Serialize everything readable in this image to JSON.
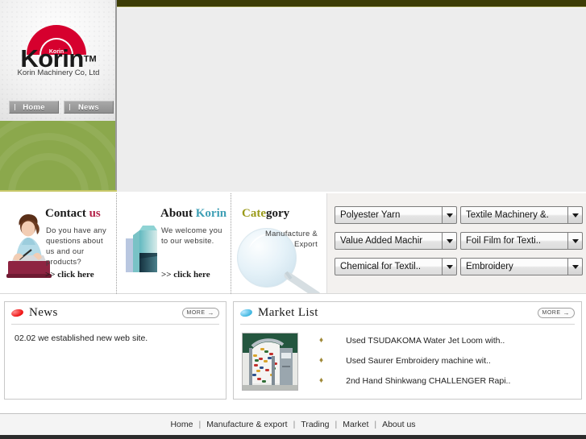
{
  "brand": {
    "name": "Korin",
    "tm": "TM",
    "company": "Korin Machinery Co, Ltd",
    "logo_icon": "concentric-arcs-logo",
    "logo_color": "#d6002e"
  },
  "nav_buttons": [
    {
      "label": "Home",
      "name": "nav-home"
    },
    {
      "label": "News",
      "name": "nav-news"
    }
  ],
  "promos": [
    {
      "title_main": "Contact",
      "title_accent": "us",
      "accent_class": "accent-red",
      "body": "Do you have any questions about us and our products?",
      "cta": ">> click here",
      "icon": "woman-at-desk-illustration"
    },
    {
      "title_main": "About",
      "title_accent": "Korin",
      "accent_class": "accent-teal",
      "body": "We welcome you to our website.",
      "cta": ">> click here",
      "icon": "office-building-illustration"
    },
    {
      "title_main": "Cate",
      "title_accent": "gory",
      "accent_class": "accent-gold",
      "body": "Manufacture & Export",
      "cta": "",
      "icon": "magnifying-glass-illustration"
    }
  ],
  "dropdowns": [
    {
      "value": "Polyester Yarn",
      "name": "dropdown-polyester-yarn"
    },
    {
      "value": "Textile Machinery &.",
      "name": "dropdown-textile-machinery"
    },
    {
      "value": "Value Added Machir",
      "name": "dropdown-value-added-machinery"
    },
    {
      "value": "Foil Film for Texti..",
      "name": "dropdown-foil-film"
    },
    {
      "value": "Chemical for Textil..",
      "name": "dropdown-chemical-for-textile"
    },
    {
      "value": "Embroidery",
      "name": "dropdown-embroidery"
    }
  ],
  "news": {
    "title": "News",
    "icon": "red-ellipse-icon",
    "more_label": "MORE",
    "more_arrow": "→",
    "items": [
      {
        "date": "02.02",
        "text": "we established new web site."
      }
    ]
  },
  "market": {
    "title": "Market  List",
    "icon": "blue-ellipse-icon",
    "more_label": "MORE",
    "more_arrow": "→",
    "thumb_alt": "textile-weaving-machine-photo",
    "bullet": "♦",
    "items": [
      "Used TSUDAKOMA Water Jet Loom with..",
      "Used Saurer Embroidery machine wit..",
      "2nd Hand Shinkwang CHALLENGER Rapi.."
    ]
  },
  "footer": {
    "separator": "|",
    "links": [
      "Home",
      "Manufacture & export",
      "Trading",
      "Market",
      "About us"
    ]
  },
  "theme": {
    "olive_bar": "#3d3d06",
    "green_panel": "#8ba84c",
    "accent_red": "#b4234a",
    "accent_teal": "#3e9fb5",
    "accent_gold": "#9a9a19",
    "page_bg": "#ededed"
  }
}
